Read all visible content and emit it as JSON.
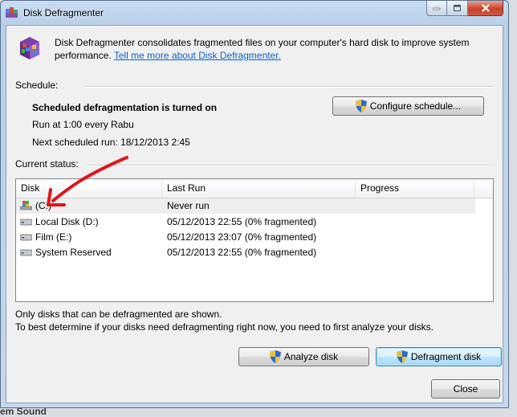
{
  "window": {
    "title": "Disk Defragmenter",
    "controls": {
      "minimize": "—",
      "maximize": "□",
      "close": "✕"
    }
  },
  "backdrop": {
    "bottom_text": "em Sound"
  },
  "intro": {
    "text": "Disk Defragmenter consolidates fragmented files on your computer's hard disk to improve system performance.",
    "link": "Tell me more about Disk Defragmenter."
  },
  "schedule": {
    "label": "Schedule:",
    "status": "Scheduled defragmentation is turned on",
    "run_at": "Run at 1:00 every Rabu",
    "next_run": "Next scheduled run: 18/12/2013 2:45",
    "configure_button": "Configure schedule..."
  },
  "current_status": {
    "label": "Current status:",
    "columns": [
      "Disk",
      "Last Run",
      "Progress"
    ],
    "rows": [
      {
        "disk": "(C:)",
        "last_run": "Never run",
        "progress": "",
        "icon": "system-drive-icon"
      },
      {
        "disk": "Local Disk (D:)",
        "last_run": "05/12/2013 22:55 (0% fragmented)",
        "progress": "",
        "icon": "hard-drive-icon"
      },
      {
        "disk": "Film (E:)",
        "last_run": "05/12/2013 23:07 (0% fragmented)",
        "progress": "",
        "icon": "hard-drive-icon"
      },
      {
        "disk": "System Reserved",
        "last_run": "05/12/2013 22:55 (0% fragmented)",
        "progress": "",
        "icon": "hard-drive-icon"
      }
    ]
  },
  "notes": {
    "line1": "Only disks that can be defragmented are shown.",
    "line2": "To best determine if your disks need defragmenting right now, you need to first analyze your disks."
  },
  "buttons": {
    "analyze": "Analyze disk",
    "defragment": "Defragment disk",
    "close": "Close"
  },
  "colors": {
    "link": "#0b64c8",
    "annotation_arrow": "#e0151b",
    "selected_row": "#eeeeef"
  }
}
